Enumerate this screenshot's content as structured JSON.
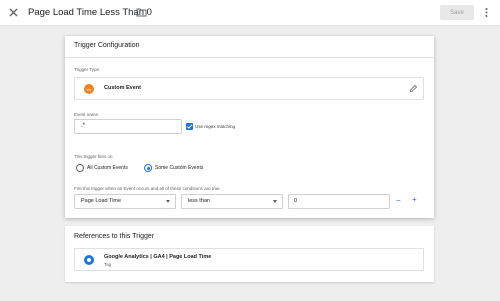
{
  "topbar": {
    "title": "Page Load Time Less Than 0",
    "save_label": "Save"
  },
  "config": {
    "header": "Trigger Configuration",
    "trigger_type_label": "Trigger Type",
    "trigger_type_name": "Custom Event",
    "event_name_label": "Event name",
    "event_name_value": ".*",
    "regex_label": "Use regex matching",
    "regex_checked": true,
    "fires_on_label": "This trigger fires on",
    "fires_on_options": [
      {
        "label": "All Custom Events",
        "selected": false
      },
      {
        "label": "Some Custom Events",
        "selected": true
      }
    ],
    "condition_text": "Fire this trigger when an Event occurs and all of these conditions are true",
    "condition": {
      "variable": "Page Load Time",
      "operator": "less than",
      "value": "0"
    },
    "minus_label": "−",
    "plus_label": "+"
  },
  "references": {
    "header": "References to this Trigger",
    "items": [
      {
        "name": "Google Analytics | GA4 | Page Load Time",
        "kind": "Tag"
      }
    ]
  },
  "colors": {
    "accent": "#1a73e8",
    "custom_event_icon": "#f4811f",
    "background": "#eeeeee"
  },
  "icons": [
    "close-icon",
    "folder-icon",
    "more-vert-icon",
    "custom-event-icon",
    "pencil-icon",
    "checkbox-check-icon",
    "ga-tag-icon"
  ]
}
